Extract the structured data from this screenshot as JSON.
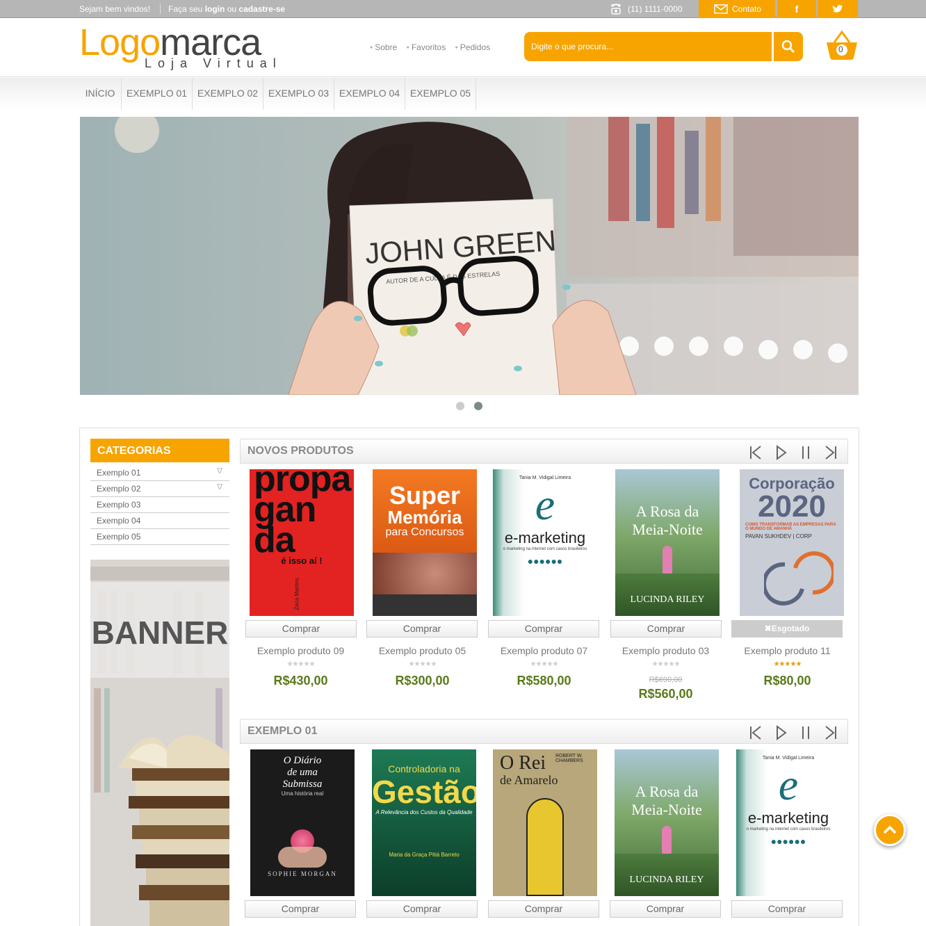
{
  "topbar": {
    "welcome": "Sejam bem vindos!",
    "login_pre": "Faça seu ",
    "login_b": "login",
    "login_mid": " ou ",
    "reg_b": "cadastre-se",
    "phone": "(11) 1111-0000",
    "contact": "Contato",
    "facebook": "f",
    "twitter": "t"
  },
  "header": {
    "logo_a": "Logo",
    "logo_b": "marca",
    "logo_sub": "Loja Virtual",
    "links": [
      "Sobre",
      "Favoritos",
      "Pedidos"
    ],
    "search_placeholder": "Digite o que procura...",
    "cart_count": "0"
  },
  "nav": [
    "INÍCIO",
    "EXEMPLO 01",
    "EXEMPLO 02",
    "EXEMPLO 03",
    "EXEMPLO 04",
    "EXEMPLO 05"
  ],
  "slider": {
    "book_title": "JOHN GREEN",
    "book_sub": "AUTOR DE A CULPA É DAS ESTRELAS",
    "slides": 2,
    "active": 2
  },
  "categories": {
    "title": "CATEGORIAS",
    "items": [
      "Exemplo 01",
      "Exemplo 02",
      "Exemplo 03",
      "Exemplo 04",
      "Exemplo 05"
    ]
  },
  "banner": "BANNER",
  "section1": {
    "title": "NOVOS PRODUTOS",
    "products": [
      {
        "name": "Exemplo produto 09",
        "price": "R$430,00",
        "buy": "Comprar",
        "rating": 0,
        "cover": "Propaganda",
        "c1": "propa",
        "c2": "gan",
        "c3": "da",
        "c4": "é isso aí !",
        "c5": "Zeca Martins"
      },
      {
        "name": "Exemplo produto 05",
        "price": "R$300,00",
        "buy": "Comprar",
        "rating": 0,
        "c1": "Super",
        "c2": "Memória",
        "c3": "para Concursos"
      },
      {
        "name": "Exemplo produto 07",
        "price": "R$580,00",
        "buy": "Comprar",
        "rating": 0,
        "c0": "Tania M. Vidigal Limeira",
        "c1": "e",
        "c2": "e-marketing",
        "c3": "o marketing na internet com casos brasileiros"
      },
      {
        "name": "Exemplo produto 03",
        "old": "R$690,00",
        "price": "R$560,00",
        "buy": "Comprar",
        "rating": 0,
        "c1": "A Rosa da",
        "c2": "Meia-Noite",
        "c3": "LUCINDA RILEY"
      },
      {
        "name": "Exemplo produto 11",
        "price": "R$80,00",
        "buy": "Esgotado",
        "rating": 5,
        "c1": "Corporação",
        "c2": "2020",
        "c3": "COMO TRANSFORMAR AS EMPRESAS PARA O MUNDO DE AMANHÃ",
        "c4": "PAVAN SUKHDEV | CORP"
      }
    ]
  },
  "section2": {
    "title": "EXEMPLO 01",
    "products": [
      {
        "buy": "Comprar",
        "c1": "O Diário",
        "c2": "de uma",
        "c3": "Submissa",
        "c4": "Uma história real",
        "c5": "SOPHIE MORGAN"
      },
      {
        "buy": "Comprar",
        "c1": "Controladoria na",
        "c2": "Gestão",
        "c3": "A Relevância dos Custos da Qualidade",
        "c4": "Maria da Graça Pitiá Barreto"
      },
      {
        "buy": "Comprar",
        "c1": "O Rei",
        "c2": "de Amarelo",
        "c3": "ROBERT W. CHAMBERS"
      },
      {
        "buy": "Comprar",
        "c1": "A Rosa da",
        "c2": "Meia-Noite",
        "c3": "LUCINDA RILEY"
      },
      {
        "buy": "Comprar",
        "c0": "Tania M. Vidigal Limeira",
        "c1": "e",
        "c2": "e-marketing",
        "c3": "o marketing na internet com casos brasileiros"
      }
    ]
  },
  "colors": {
    "accent": "#f7a400",
    "price": "#5a7a1a",
    "topbar": "#b6b6b6"
  },
  "icons": [
    "phone-icon",
    "mail-icon",
    "facebook-icon",
    "twitter-icon",
    "search-icon",
    "cart-icon",
    "first-icon",
    "play-icon",
    "pause-icon",
    "last-icon",
    "chevron-down-icon",
    "arrow-up-icon"
  ]
}
